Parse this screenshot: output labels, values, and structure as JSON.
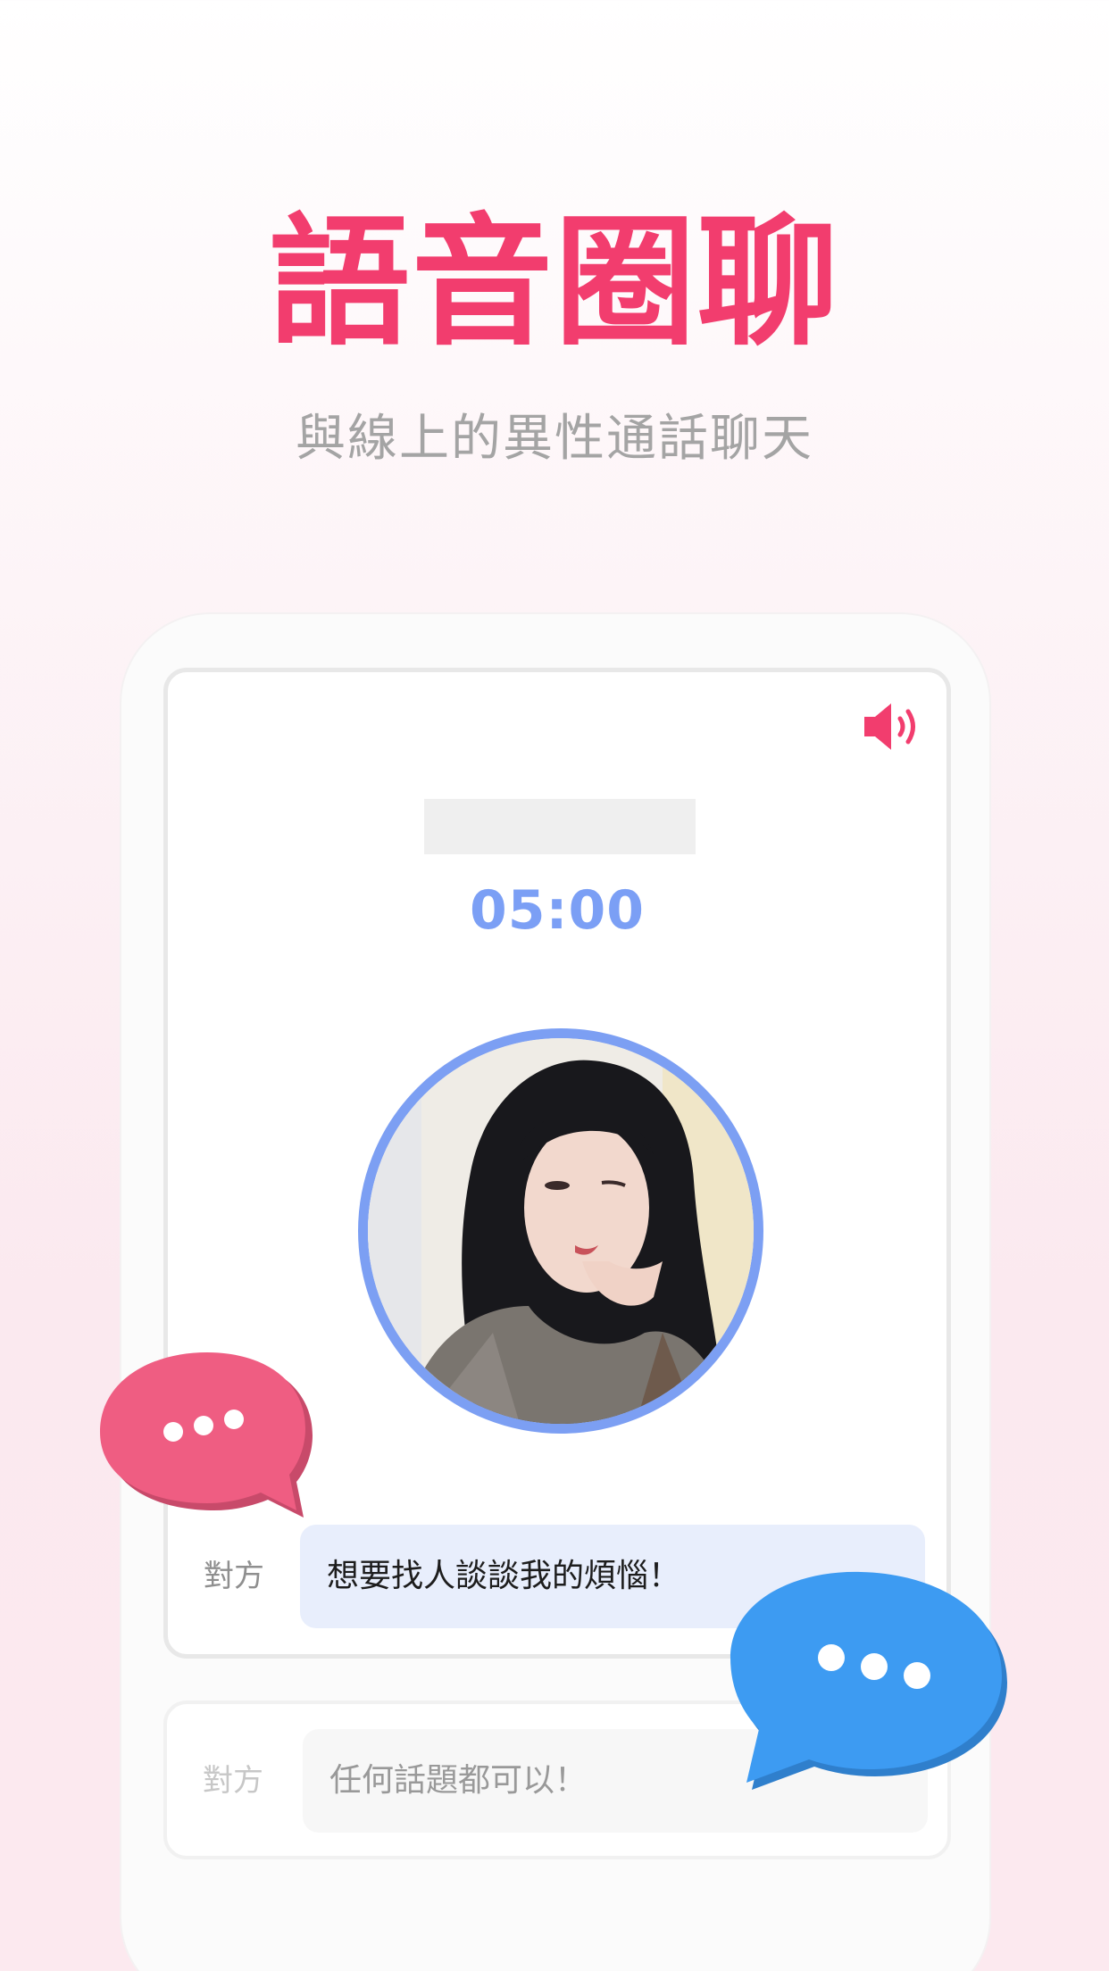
{
  "headline": "語音圈聊",
  "subheadline": "與線上的異性通話聊天",
  "call": {
    "timer": "05:00",
    "speaker_icon": "speaker-volume-icon"
  },
  "messages": [
    {
      "sender": "對方",
      "text": "想要找人談談我的煩惱！"
    },
    {
      "sender": "對方",
      "text": "任何話題都可以！"
    }
  ],
  "colors": {
    "accent_pink": "#f23d6e",
    "timer_blue": "#7b9ff5",
    "bubble_blue": "#e8eefc",
    "chat_icon_pink": "#ef5d82",
    "chat_icon_blue": "#3d9bf2"
  }
}
